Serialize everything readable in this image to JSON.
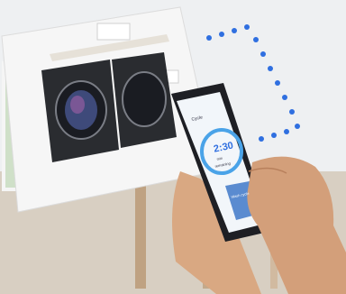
{
  "phone_screen": {
    "cycle_label": "Cycle",
    "time_remaining": "2:30",
    "time_unit": "min",
    "status_caption": "remaining",
    "bottom_label": "Wash cycle"
  },
  "colors": {
    "wall": "#eef0f2",
    "shelf": "#f4f2ee",
    "washer_body": "#2a2c30",
    "drum_glass": "#1a1c22",
    "wifi_dots": "#2f6fe0",
    "screen_accent": "#4aa3e8",
    "skin": "#d9a882"
  },
  "icons": [
    "wifi-signal-icon",
    "washer-icon",
    "dryer-icon",
    "smartphone-icon"
  ]
}
